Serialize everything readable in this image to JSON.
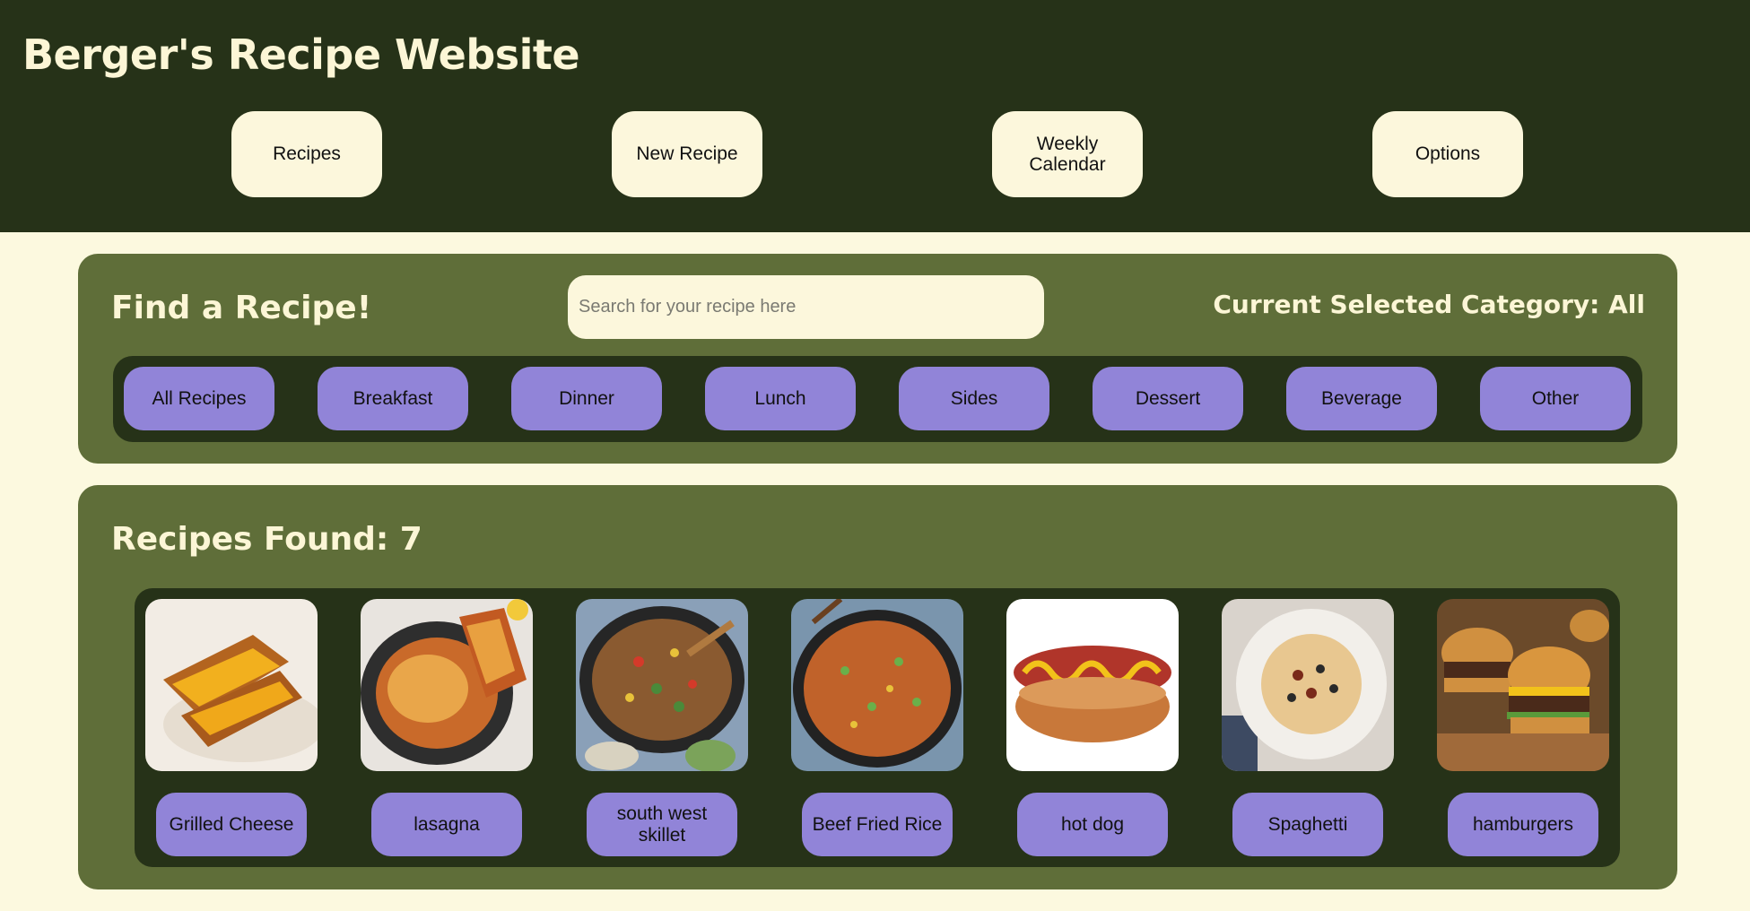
{
  "header": {
    "title": "Berger's Recipe Website",
    "nav": [
      {
        "label": "Recipes"
      },
      {
        "label": "New Recipe"
      },
      {
        "label": "Weekly Calendar"
      },
      {
        "label": "Options"
      }
    ]
  },
  "find": {
    "heading": "Find a Recipe!",
    "search_placeholder": "Search for your recipe here",
    "search_value": "",
    "current_category": "Current Selected Category: All",
    "categories": [
      "All Recipes",
      "Breakfast",
      "Dinner",
      "Lunch",
      "Sides",
      "Dessert",
      "Beverage",
      "Other"
    ]
  },
  "results": {
    "heading": "Recipes Found: 7",
    "recipes": [
      {
        "name": "Grilled Cheese",
        "icon": "grilled-cheese-photo"
      },
      {
        "name": "lasagna",
        "icon": "lasagna-photo"
      },
      {
        "name": "south west skillet",
        "icon": "skillet-photo"
      },
      {
        "name": "Beef Fried Rice",
        "icon": "fried-rice-photo"
      },
      {
        "name": "hot dog",
        "icon": "hot-dog-photo"
      },
      {
        "name": "Spaghetti",
        "icon": "spaghetti-photo"
      },
      {
        "name": "hamburgers",
        "icon": "hamburger-photo"
      }
    ]
  },
  "colors": {
    "header_bg": "#263218",
    "page_bg": "#fcf9df",
    "panel_bg": "#5f6e39",
    "button_light": "#fcf7dc",
    "button_purple": "#9184d8"
  }
}
